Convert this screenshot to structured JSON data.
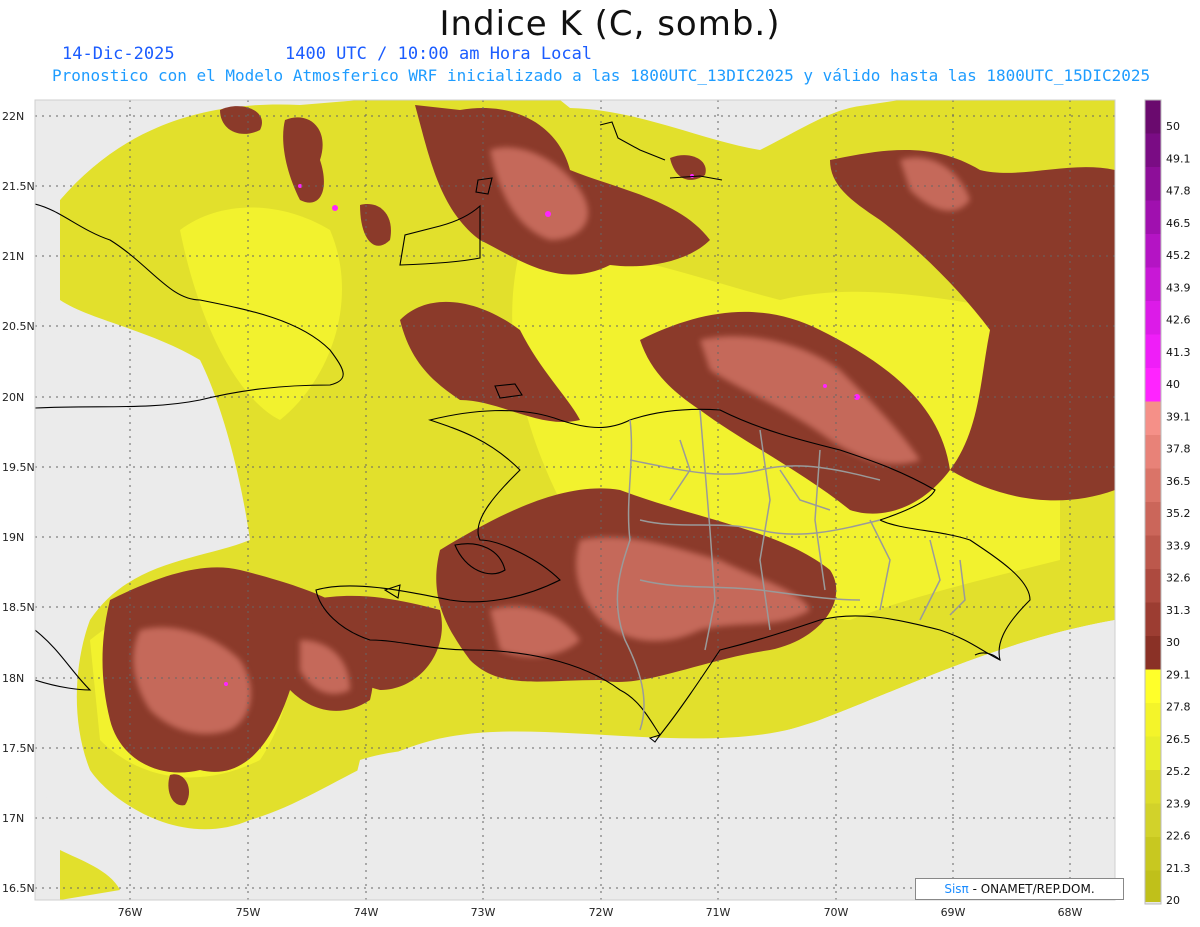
{
  "header": {
    "title": "Indice K (C, somb.)",
    "date": "14-Dic-2025",
    "time": "1400 UTC / 10:00 am Hora Local",
    "subtitle": "Pronostico con el Modelo Atmosferico WRF inicializado a las 1800UTC_13DIC2025 y válido hasta las  1800UTC_15DIC2025"
  },
  "map": {
    "lat_labels": [
      "22N",
      "21.5N",
      "21N",
      "20.5N",
      "20N",
      "19.5N",
      "19N",
      "18.5N",
      "18N",
      "17.5N",
      "17N",
      "16.5N"
    ],
    "lon_labels": [
      "76W",
      "75W",
      "74W",
      "73W",
      "72W",
      "71W",
      "70W",
      "69W",
      "68W"
    ],
    "background_color": "#ebebeb",
    "coast_color": "#000000",
    "border_color": "#9a9a9a"
  },
  "colorbar": {
    "labels": [
      "50",
      "49.1",
      "47.8",
      "46.5",
      "45.2",
      "43.9",
      "42.6",
      "41.3",
      "40",
      "39.1",
      "37.8",
      "36.5",
      "35.2",
      "33.9",
      "32.6",
      "31.3",
      "30",
      "29.1",
      "27.8",
      "26.5",
      "25.2",
      "23.9",
      "22.6",
      "21.3",
      "20"
    ],
    "colors": [
      "#6a0a6e",
      "#7a0c84",
      "#8d0e99",
      "#a010af",
      "#b414c4",
      "#c818d6",
      "#dc1be8",
      "#ef1ef8",
      "#ff24ff",
      "#f59088",
      "#e88278",
      "#da7468",
      "#cb665a",
      "#bc584c",
      "#ad4a3f",
      "#9c3d32",
      "#8a3126",
      "#ffff2a",
      "#f4f42a",
      "#e8ee2c",
      "#dcdc2a",
      "#d2d22a",
      "#c8c820",
      "#c0c01a"
    ]
  },
  "credit": {
    "brand": "Sisπ",
    "text": " - ONAMET/REP.DOM."
  }
}
